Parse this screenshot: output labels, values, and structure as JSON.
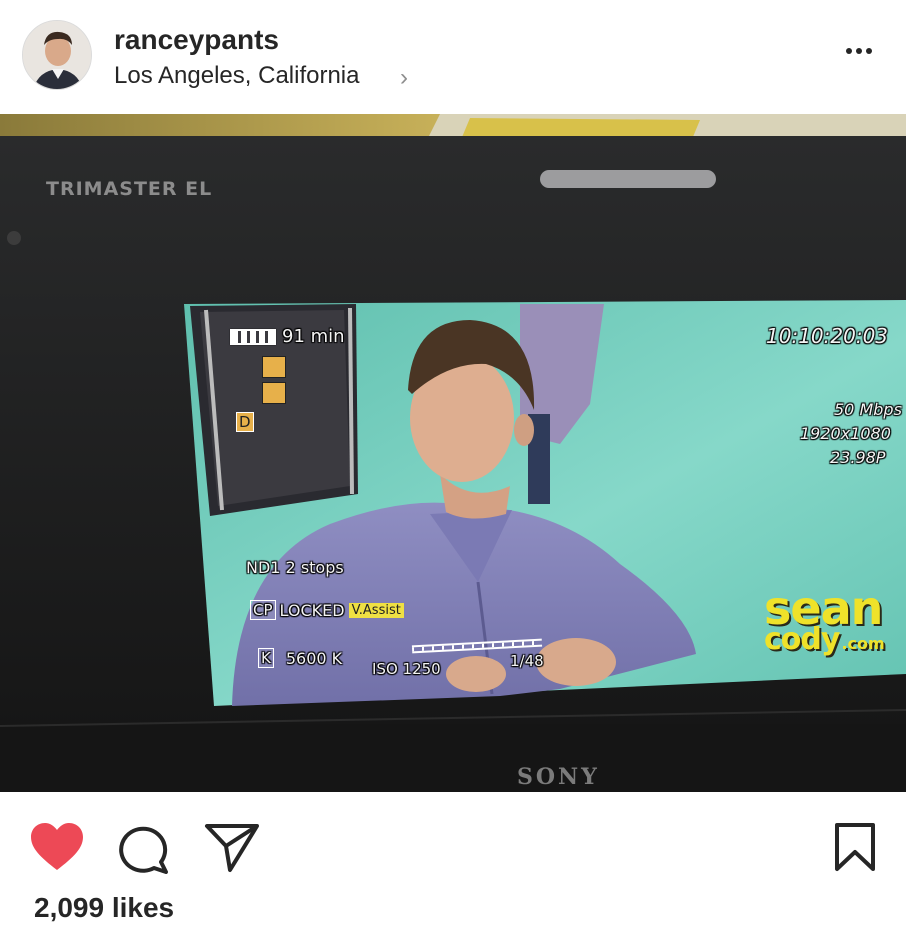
{
  "post": {
    "username": "ranceypants",
    "location": "Los Angeles, California",
    "location_chevron": "›",
    "likes": "2,099 likes"
  },
  "photo": {
    "monitor_brand": "TRIMASTER EL",
    "monitor_maker": "SONY",
    "osd": {
      "battery": "91 min",
      "timecode": "10:10:20:03",
      "bitrate": "50 Mbps",
      "resolution": "1920x1080",
      "framerate": "23.98P",
      "nd": "ND1  2 stops",
      "cp_tag": "CP",
      "cp_status": "LOCKED",
      "assist": "V.Assist",
      "k_tag": "K",
      "white_balance": "5600 K",
      "iso": "ISO 1250",
      "shutter": "1/48",
      "d_tag": "D"
    },
    "watermark": {
      "line1": "sean",
      "line2": "cody",
      "suffix": ".com"
    }
  },
  "icons": {
    "avatar": "profile-avatar",
    "more": "more-options-icon",
    "like": "heart-icon",
    "comment": "comment-icon",
    "share": "send-icon",
    "save": "bookmark-icon"
  },
  "colors": {
    "heart": "#ed4956",
    "text": "#262626",
    "secondary": "#8e8e8e",
    "screen_bg": "#7fd3c3",
    "watermark": "#efe22a"
  }
}
